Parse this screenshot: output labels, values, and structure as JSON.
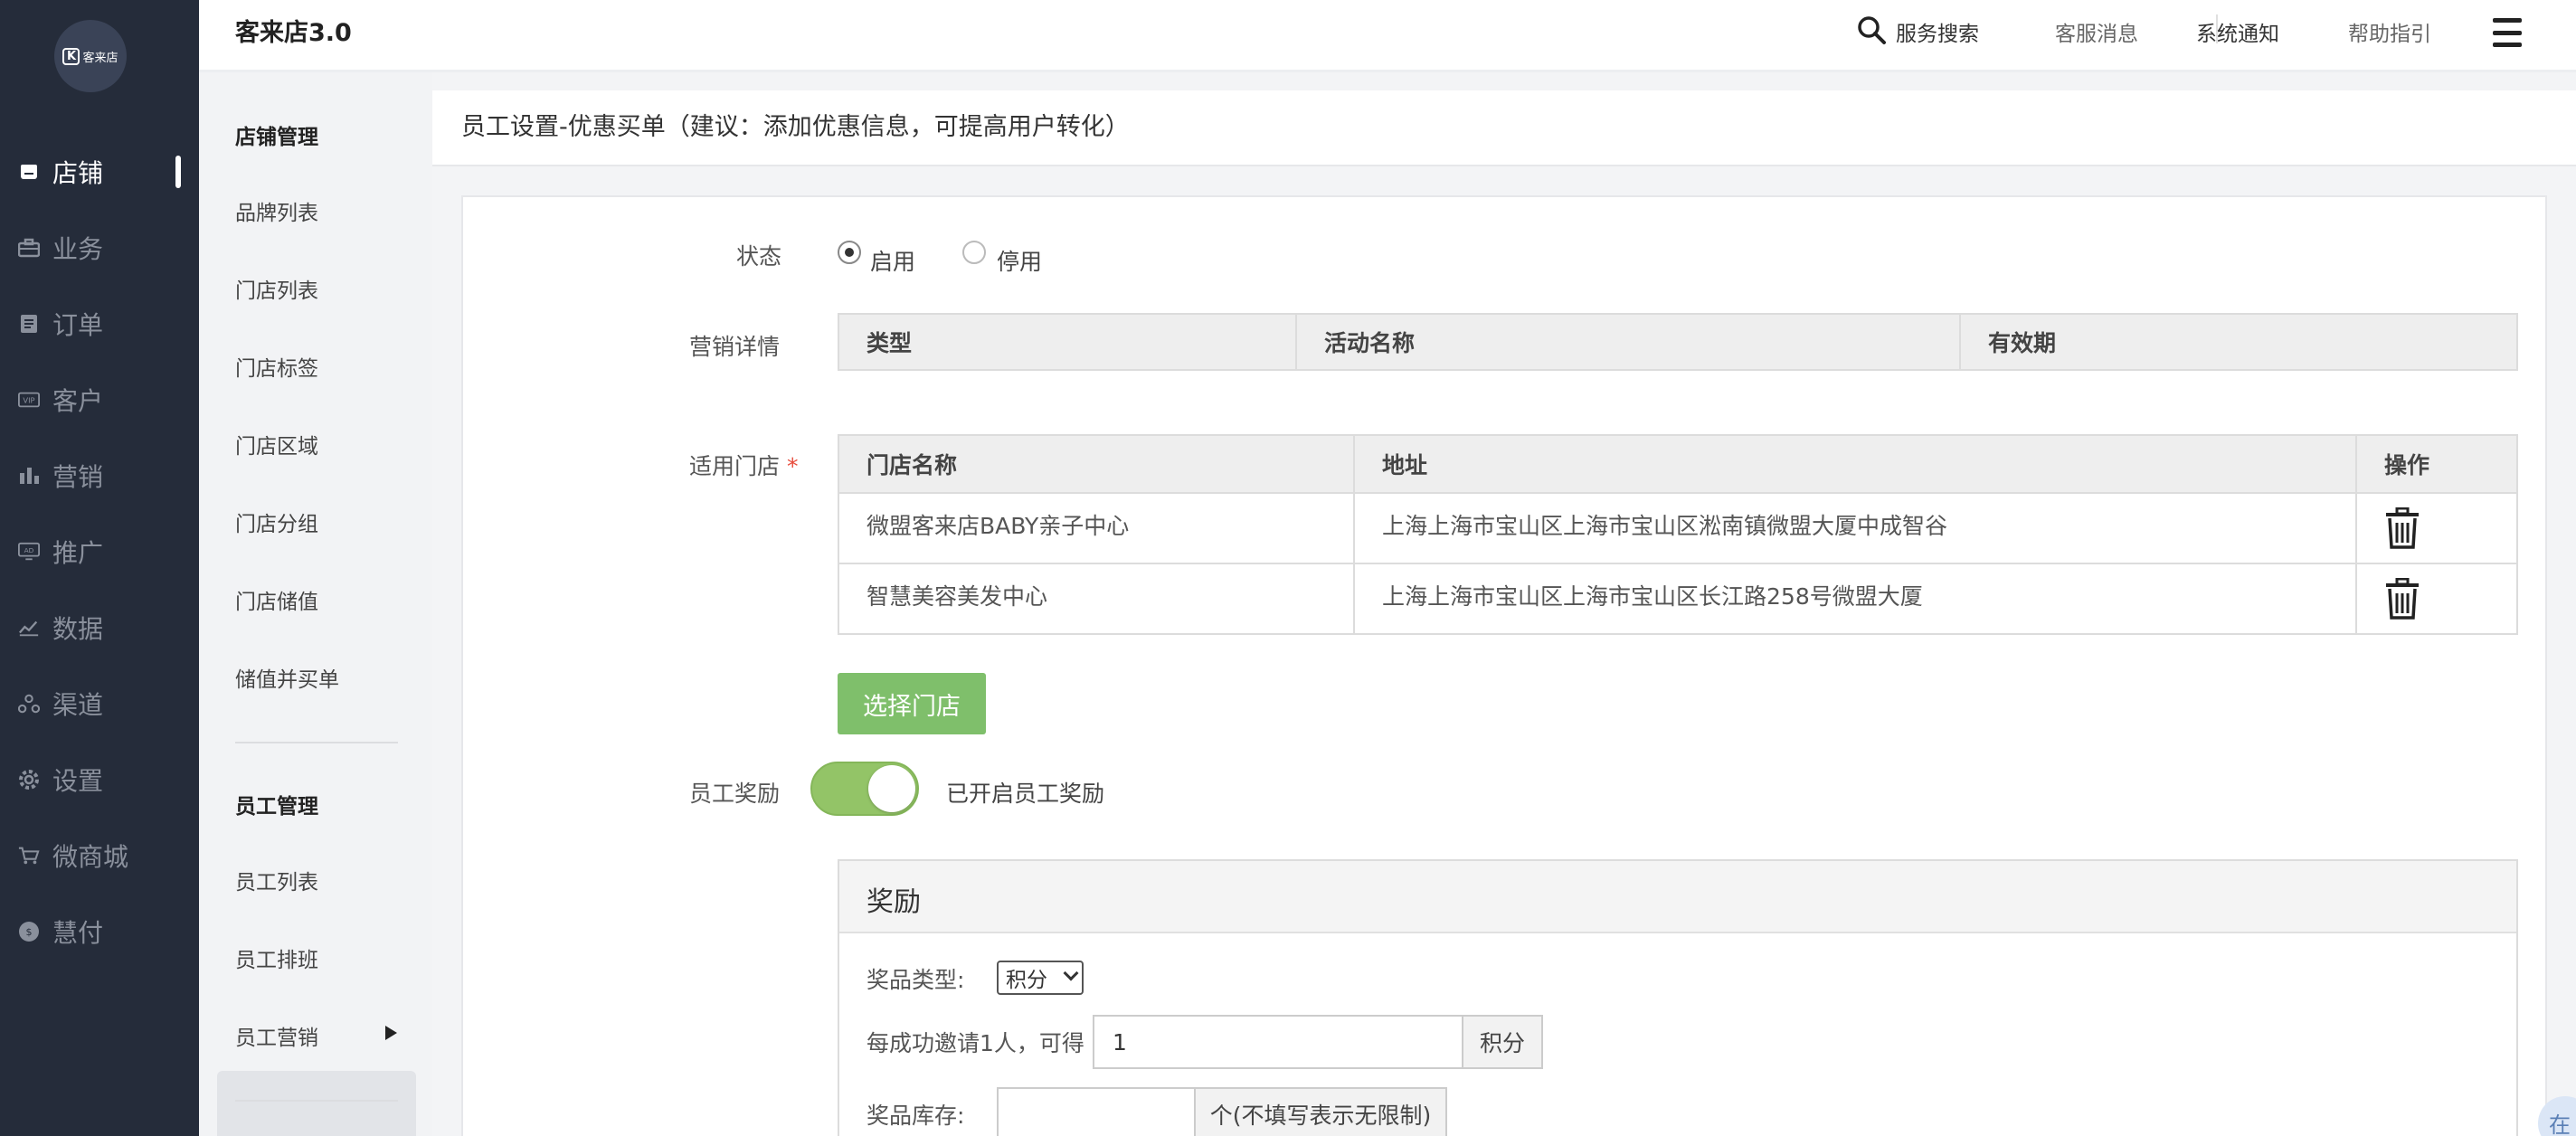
{
  "app": {
    "title": "客来店3.0",
    "logo_text": "客来店",
    "logo_letter": "K"
  },
  "header": {
    "search_label": "服务搜索",
    "links": [
      "客服消息",
      "系统通知",
      "帮助指引"
    ]
  },
  "nav": {
    "items": [
      {
        "label": "店铺",
        "icon": "store-icon",
        "active": true
      },
      {
        "label": "业务",
        "icon": "briefcase-icon",
        "active": false
      },
      {
        "label": "订单",
        "icon": "order-icon",
        "active": false
      },
      {
        "label": "客户",
        "icon": "vip-icon",
        "active": false
      },
      {
        "label": "营销",
        "icon": "bar-chart-icon",
        "active": false
      },
      {
        "label": "推广",
        "icon": "ad-icon",
        "active": false
      },
      {
        "label": "数据",
        "icon": "line-chart-icon",
        "active": false
      },
      {
        "label": "渠道",
        "icon": "channel-icon",
        "active": false
      },
      {
        "label": "设置",
        "icon": "gear-icon",
        "active": false
      },
      {
        "label": "微商城",
        "icon": "cart-icon",
        "active": false
      },
      {
        "label": "慧付",
        "icon": "coin-icon",
        "active": false
      }
    ]
  },
  "submenu": {
    "store_section_title": "店铺管理",
    "store_items": [
      "品牌列表",
      "门店列表",
      "门店标签",
      "门店区域",
      "门店分组",
      "门店储值",
      "储值并买单"
    ],
    "staff_section_title": "员工管理",
    "staff_items": [
      "员工列表",
      "员工排班",
      "员工营销"
    ],
    "active_item": "员工营销"
  },
  "page": {
    "title": "员工设置-优惠买单（建议：添加优惠信息，可提高用户转化）"
  },
  "form": {
    "status_label": "状态",
    "status_options": [
      "启用",
      "停用"
    ],
    "status_selected": "启用",
    "marketing_label": "营销详情",
    "marketing_columns": [
      "类型",
      "活动名称",
      "有效期"
    ],
    "stores_label": "适用门店",
    "stores_required_mark": "*",
    "stores_columns": [
      "门店名称",
      "地址",
      "操作"
    ],
    "stores_rows": [
      {
        "name": "微盟客来店BABY亲子中心",
        "address": "上海上海市宝山区上海市宝山区淞南镇微盟大厦中成智谷"
      },
      {
        "name": "智慧美容美发中心",
        "address": "上海上海市宝山区上海市宝山区长江路258号微盟大厦"
      }
    ],
    "select_store_button": "选择门店",
    "staff_reward_label": "员工奖励",
    "staff_reward_enabled": true,
    "staff_reward_status_text": "已开启员工奖励",
    "colors": {
      "toggle": "#93c467",
      "button": "#7fbf6b",
      "nav_bg": "#252c3a"
    }
  },
  "reward_panel": {
    "title": "奖励",
    "prize_type_label": "奖品类型:",
    "prize_type_value": "积分",
    "per_invite_label": "每成功邀请1人，可得",
    "per_invite_value": "1",
    "per_invite_unit": "积分",
    "stock_label": "奖品库存:",
    "stock_value": "",
    "stock_hint": "个(不填写表示无限制)"
  },
  "corner_button": "在"
}
